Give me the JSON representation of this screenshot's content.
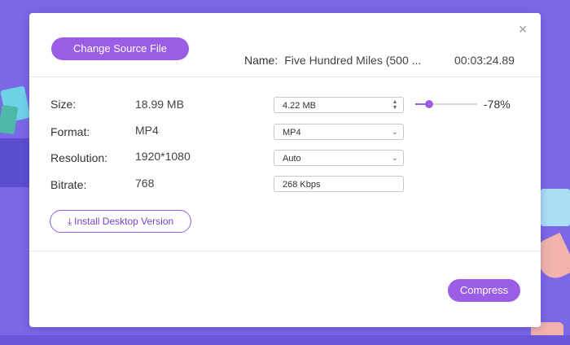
{
  "dialog": {
    "change_source_label": "Change Source File",
    "name_label": "Name:",
    "name_value": "Five Hundred Miles (500 ...",
    "duration": "00:03:24.89",
    "close_icon": "×",
    "rows": {
      "size": {
        "label": "Size:",
        "original": "18.99 MB",
        "target": "4.22  MB"
      },
      "format": {
        "label": "Format:",
        "original": "MP4",
        "target": "MP4"
      },
      "resolution": {
        "label": "Resolution:",
        "original": "1920*1080",
        "target": "Auto"
      },
      "bitrate": {
        "label": "Bitrate:",
        "original": "768",
        "target": "268 Kbps"
      }
    },
    "compression_slider_fraction": 0.22,
    "compression_percent": "-78%",
    "install_label": "Install Desktop Version",
    "install_icon": "download-icon",
    "compress_label": "Compress"
  },
  "colors": {
    "accent": "#9b5de5",
    "background": "#7b68e6"
  }
}
